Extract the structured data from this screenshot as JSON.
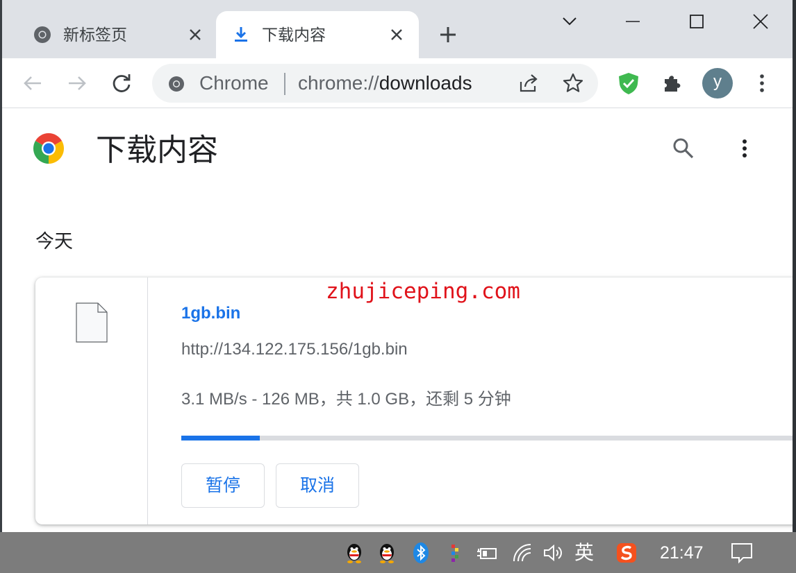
{
  "tabs": [
    {
      "title": "新标签页",
      "active": false
    },
    {
      "title": "下载内容",
      "active": true
    }
  ],
  "omnibox": {
    "site_chip": "Chrome",
    "url_scheme": "chrome://",
    "url_host": "downloads"
  },
  "profile": {
    "avatar_letter": "y"
  },
  "page": {
    "title": "下载内容",
    "section_date": "今天"
  },
  "download": {
    "watermark": "zhujiceping.com",
    "file_name": "1gb.bin",
    "url": "http://134.122.175.156/1gb.bin",
    "status": "3.1 MB/s - 126 MB，共 1.0 GB，还剩 5 分钟",
    "progress_fraction": 0.126,
    "pause_label": "暂停",
    "cancel_label": "取消"
  },
  "taskbar": {
    "ime_label": "英",
    "time": "21:47"
  },
  "colors": {
    "accent": "#1a73e8",
    "tabstrip": "#dee1e6",
    "taskbar": "#7c7c7c",
    "watermark": "#e0121a"
  },
  "icons": [
    "chrome-icon",
    "download-icon",
    "close-icon",
    "plus-icon",
    "chevron-down-icon",
    "minimize-icon",
    "maximize-icon",
    "back-icon",
    "forward-icon",
    "reload-icon",
    "share-icon",
    "star-icon",
    "shield-check-icon",
    "puzzle-icon",
    "more-vert-icon",
    "search-icon",
    "file-icon",
    "qq-icon",
    "bluetooth-icon",
    "battery-icon",
    "wifi-icon",
    "volume-icon",
    "sogou-icon",
    "notification-icon"
  ]
}
